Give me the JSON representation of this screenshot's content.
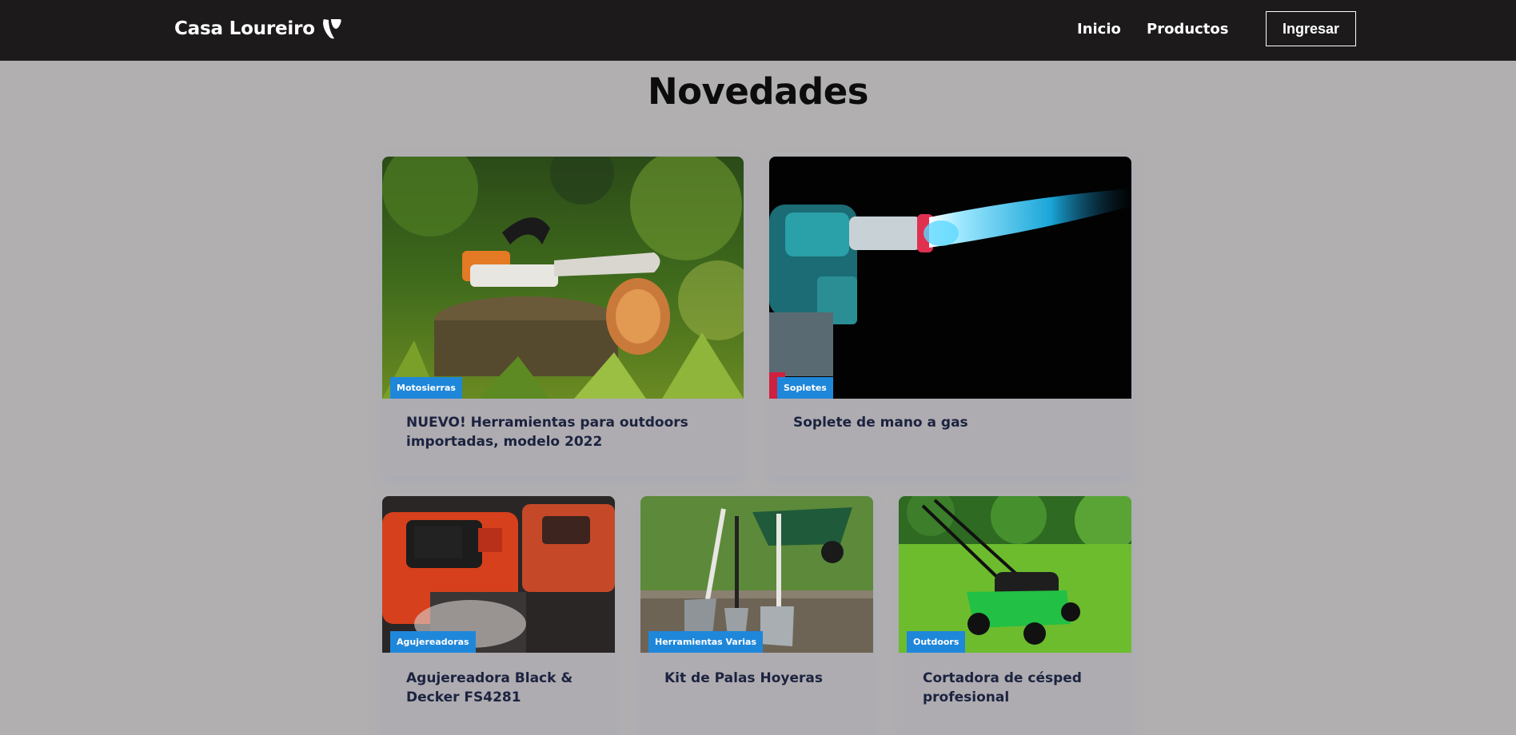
{
  "navbar": {
    "brand": "Casa Loureiro",
    "brand_icon": "typo3-logo-icon",
    "links": [
      "Inicio",
      "Productos"
    ],
    "login_label": "Ingresar"
  },
  "page": {
    "title": "Novedades"
  },
  "cards": [
    {
      "category": "Motosierras",
      "title": "NUEVO! Herramientas para outdoors importadas, modelo 2022",
      "image": "chainsaw-on-stump"
    },
    {
      "category": "Sopletes",
      "title": "Soplete de mano a gas",
      "image": "gas-torch-flame"
    },
    {
      "category": "Agujereadoras",
      "title": "Agujereadora Black & Decker FS4281",
      "image": "black-decker-drills"
    },
    {
      "category": "Herramientas Varias",
      "title": "Kit de Palas Hoyeras",
      "image": "shovels-and-wheelbarrow"
    },
    {
      "category": "Outdoors",
      "title": "Cortadora de césped profesional",
      "image": "lawn-mower"
    }
  ],
  "colors": {
    "navbar_bg": "#1c1a1a",
    "page_bg": "#b1afb0",
    "badge_bg": "#1f87da",
    "card_title": "#1c2340"
  }
}
